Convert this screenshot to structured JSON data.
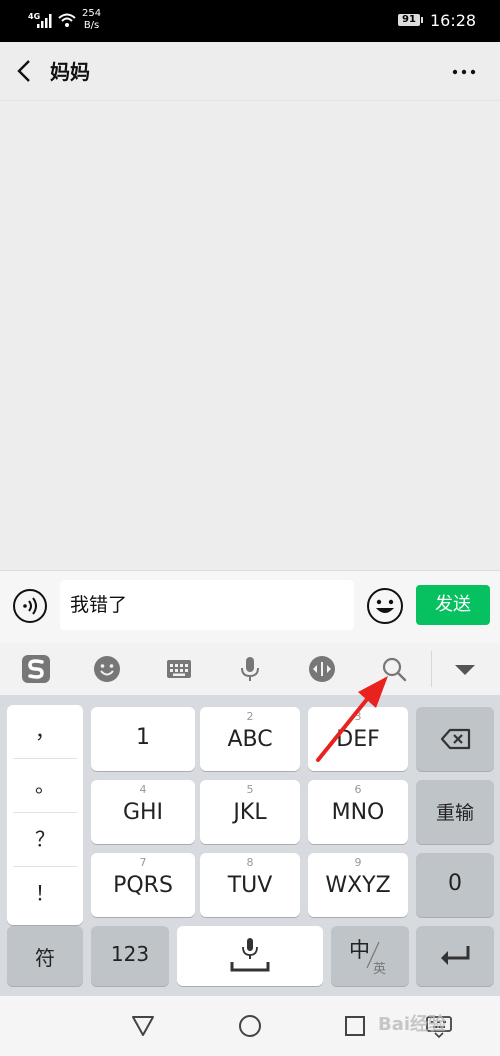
{
  "status_bar": {
    "network": "4G",
    "speed_value": "254",
    "speed_unit": "B/s",
    "battery": "91",
    "time": "16:28"
  },
  "nav": {
    "title": "妈妈",
    "back_icon": "chevron-left-icon",
    "more_icon": "more-dots-icon"
  },
  "input_bar": {
    "message_text": "我错了",
    "send_label": "发送",
    "voice_icon": "voice-icon",
    "emoji_icon": "emoji-icon"
  },
  "keyboard_toolbar": {
    "items": [
      "sogou-logo-icon",
      "emoji-icon",
      "keyboard-icon",
      "microphone-icon",
      "cursor-move-icon",
      "search-icon",
      "collapse-icon"
    ]
  },
  "keyboard": {
    "punctuation": [
      "，",
      "。",
      "？",
      "！"
    ],
    "keys": [
      {
        "main": "1",
        "sub": ""
      },
      {
        "main": "ABC",
        "sub": "2"
      },
      {
        "main": "DEF",
        "sub": "3"
      },
      {
        "main": "GHI",
        "sub": "4"
      },
      {
        "main": "JKL",
        "sub": "5"
      },
      {
        "main": "MNO",
        "sub": "6"
      },
      {
        "main": "PQRS",
        "sub": "7"
      },
      {
        "main": "TUV",
        "sub": "8"
      },
      {
        "main": "WXYZ",
        "sub": "9"
      }
    ],
    "relogin_label": "重输",
    "zero_label": "0",
    "symbol_label": "符",
    "numbers_label": "123",
    "lang_main": "中",
    "lang_sub": "英",
    "backspace_icon": "backspace-icon",
    "enter_icon": "enter-icon",
    "space_mic_icon": "microphone-icon"
  },
  "bottom_nav": {
    "items": [
      "back-triangle-icon",
      "home-circle-icon",
      "recents-square-icon",
      "keyboard-hide-icon"
    ]
  },
  "watermark": "Bai经验",
  "colors": {
    "send_green": "#07c160",
    "arrow_red": "#e8231f"
  }
}
